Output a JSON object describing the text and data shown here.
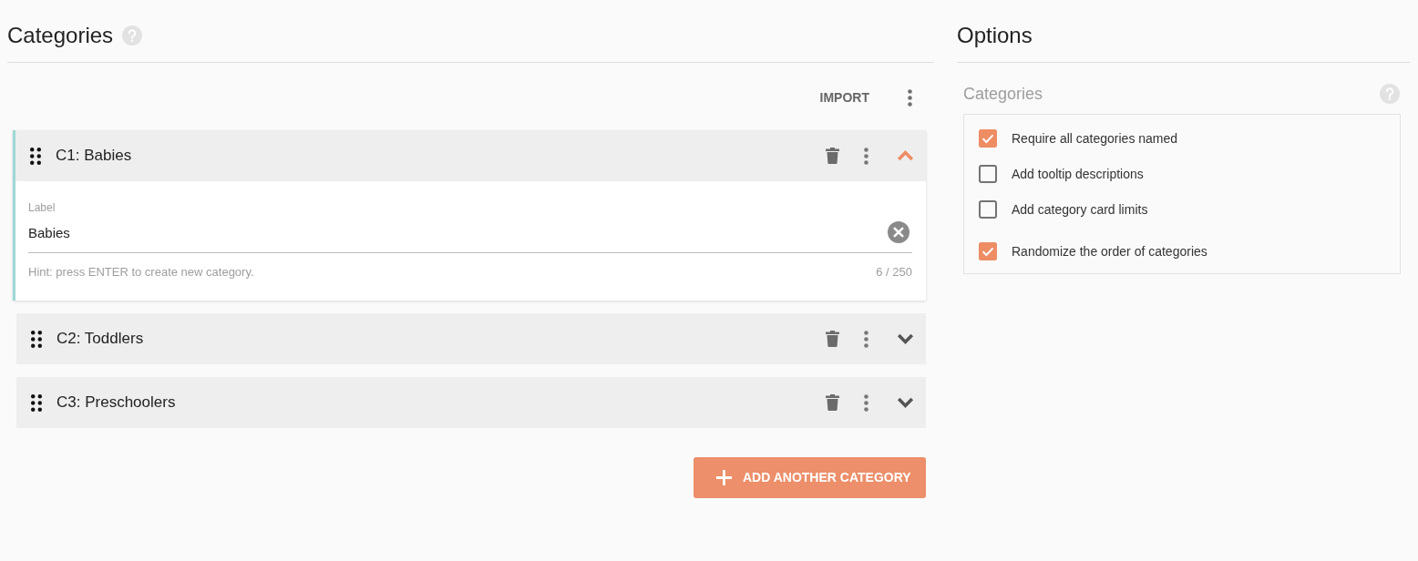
{
  "categories_panel": {
    "title": "Categories",
    "import_button": "IMPORT",
    "categories": [
      {
        "title": "C1: Babies",
        "expanded": true,
        "field": {
          "label": "Label",
          "value": "Babies",
          "hint": "Hint: press ENTER to create new category.",
          "counter": "6 / 250"
        }
      },
      {
        "title": "C2: Toddlers",
        "expanded": false
      },
      {
        "title": "C3: Preschoolers",
        "expanded": false
      }
    ],
    "add_button": "ADD ANOTHER CATEGORY"
  },
  "options_panel": {
    "title": "Options",
    "section_title": "Categories",
    "options": [
      {
        "label": "Require all categories named",
        "checked": true
      },
      {
        "label": "Add tooltip descriptions",
        "checked": false
      },
      {
        "label": "Add category card limits",
        "checked": false
      },
      {
        "label": "Randomize the order of categories",
        "checked": true
      }
    ]
  }
}
